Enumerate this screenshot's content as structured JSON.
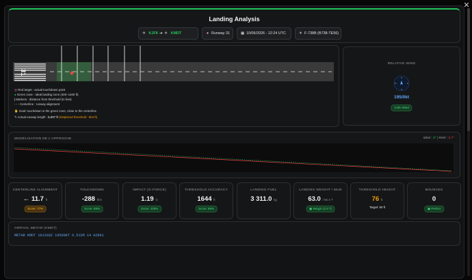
{
  "header": {
    "title": "Landing Analysis",
    "origin": "KJFK",
    "destination": "KMDT",
    "runway": "Runway 31",
    "datetime": "10/05/2026 - 12:24 UTC",
    "aircraft": "F-738B (B738-TE56)"
  },
  "runway": {
    "number": "31",
    "markers": [
      "500",
      "1000",
      "1500",
      "2000",
      "2500",
      "3000"
    ],
    "legend": {
      "red_target": "Red target : actual touchdown point",
      "green_zone": "Green zone : Ideal landing zone (400–1400 ft)",
      "markers": "Markers : distance from threshold (in feet)",
      "centerline": "Centerline : runway alignment",
      "goal": "Goal: touchdown in the green zone, close to the centerline",
      "length_label": "Actual runway length :",
      "length_value": "6,007 ft",
      "displaced": "(Displaced threshold : 904 ft)"
    }
  },
  "wind": {
    "title": "RELATIVE WIND",
    "value": "195/0kt",
    "badge": "Calm Wind"
  },
  "approach": {
    "title": "MODÉLISATION DE L'APPROCHE",
    "ideal_label": "Idéal :",
    "ideal_value": "3°",
    "real_label": "| Réel :",
    "real_value": "2.7°"
  },
  "metrics": [
    {
      "label": "CENTERLINE ALIGNMENT",
      "value": "← 11.7",
      "unit": "ft",
      "badge": "Score: 77%",
      "badge_color": "orange"
    },
    {
      "label": "TOUCHDOWN",
      "value": "-288",
      "unit": "ft/m",
      "badge": "Score: 89%",
      "badge_color": "green"
    },
    {
      "label": "IMPACT (G-FORCE)",
      "value": "1.19",
      "unit": "G",
      "badge": "Score: 100%",
      "badge_color": "green"
    },
    {
      "label": "THRESHOLD ACCURACY",
      "value": "1644",
      "unit": "ft",
      "badge": "Score: 98%",
      "badge_color": "green"
    },
    {
      "label": "LANDING FUEL",
      "value": "3 311.0",
      "unit": "kg",
      "badge": "",
      "badge_color": ""
    },
    {
      "label": "LANDING WEIGHT / MLW",
      "value": "63.0",
      "unit": "/ 66.4  T",
      "badge": "Margin (3.3 T)",
      "badge_color": "green"
    },
    {
      "label": "THRESHOLD HEIGHT",
      "value": "76",
      "unit": "ft",
      "badge": "Target: 50 ft",
      "badge_color": "plain"
    },
    {
      "label": "BOUNCES",
      "value": "0",
      "unit": "",
      "badge": "Perfect",
      "badge_color": "green"
    }
  ],
  "metar": {
    "title": "ARRIVAL METAR (KMDT)",
    "text": "METAR KMDT 101318Z 19500KT 6.51SM 14 A2991"
  },
  "colors": {
    "accent": "#22c55e",
    "warning": "#f59e0b",
    "danger": "#ef4444",
    "info": "#60a5fa"
  }
}
